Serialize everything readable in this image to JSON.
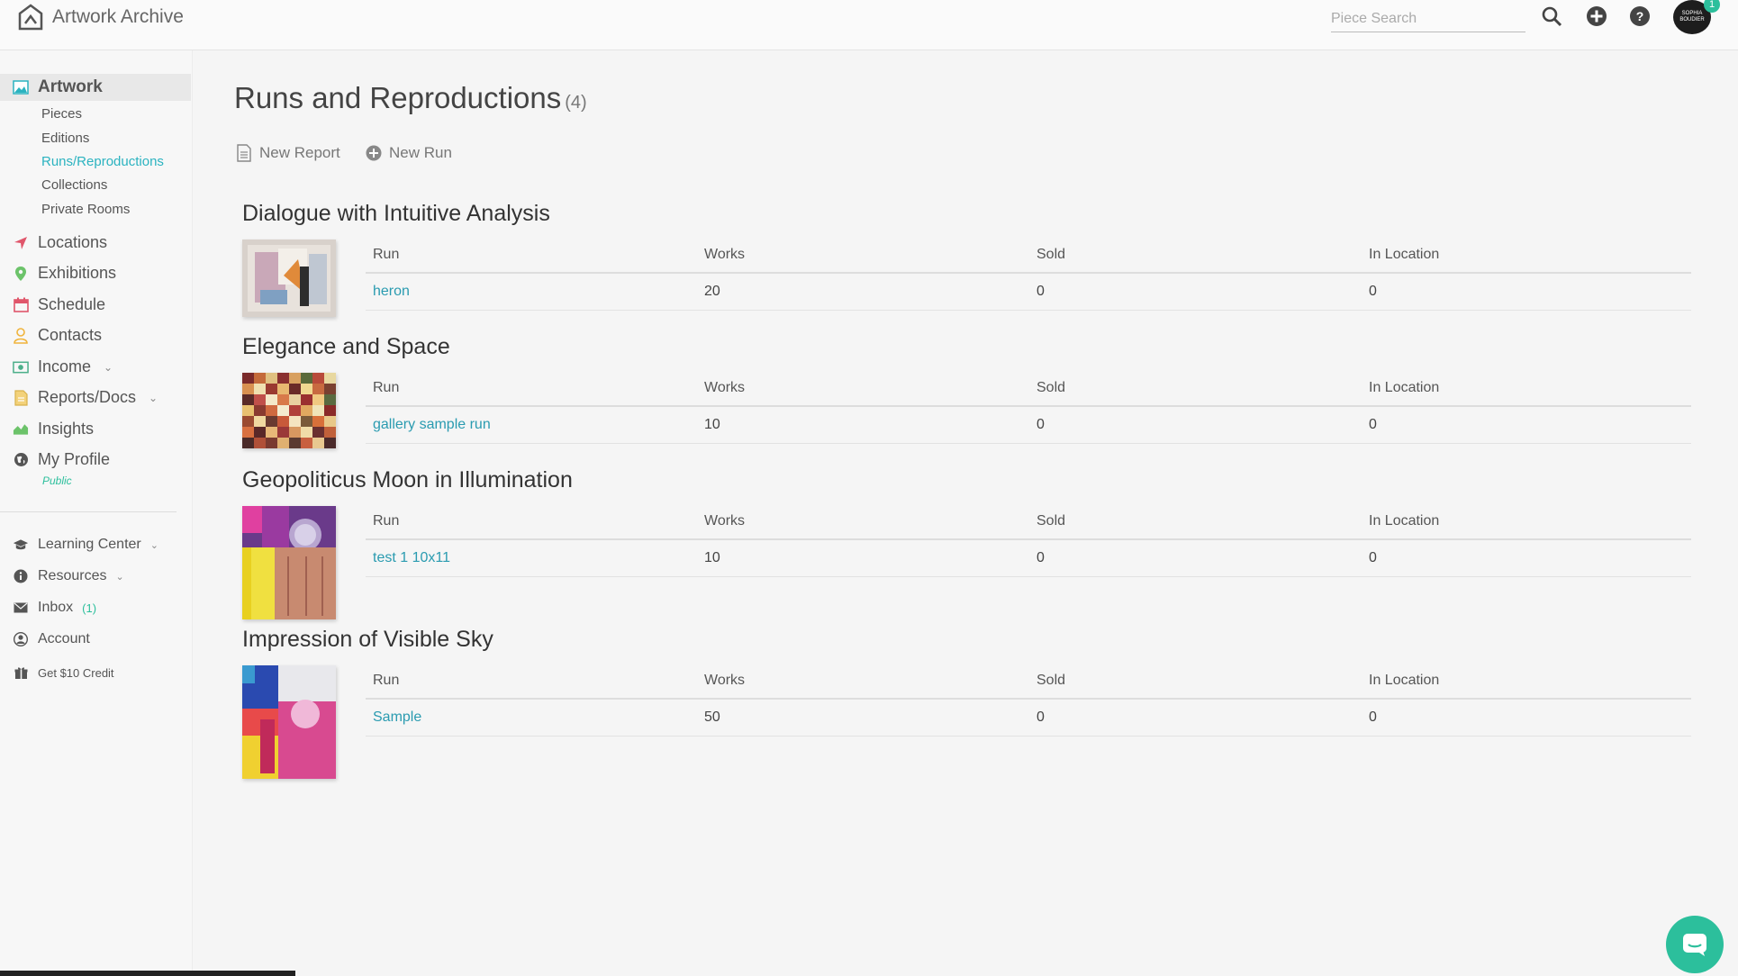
{
  "app": {
    "title": "Artwork Archive"
  },
  "header": {
    "search_placeholder": "Piece Search",
    "avatar_text": "SOPHIA BOUDIER",
    "notification_count": "1"
  },
  "sidebar": {
    "main_label": "Artwork",
    "sub_items": [
      "Pieces",
      "Editions",
      "Runs/Reproductions",
      "Collections",
      "Private Rooms"
    ],
    "active_sub": "Runs/Reproductions",
    "items": [
      "Locations",
      "Exhibitions",
      "Schedule",
      "Contacts",
      "Income",
      "Reports/Docs",
      "Insights",
      "My Profile"
    ],
    "profile_tag": "Public",
    "bottom_items": [
      "Learning Center",
      "Resources",
      "Inbox",
      "Account",
      "Get $10 Credit"
    ],
    "inbox_count": "(1)"
  },
  "page": {
    "title": "Runs and Reproductions",
    "count": "(4)",
    "actions": {
      "new_report": "New Report",
      "new_run": "New Run"
    }
  },
  "table_headers": {
    "run": "Run",
    "works": "Works",
    "sold": "Sold",
    "in_location": "In Location"
  },
  "pieces": [
    {
      "title": "Dialogue with Intuitive Analysis",
      "run": "heron",
      "works": "20",
      "sold": "0",
      "in_location": "0"
    },
    {
      "title": "Elegance and Space",
      "run": "gallery sample run",
      "works": "10",
      "sold": "0",
      "in_location": "0"
    },
    {
      "title": "Geopoliticus Moon in Illumination",
      "run": "test 1 10x11",
      "works": "10",
      "sold": "0",
      "in_location": "0"
    },
    {
      "title": "Impression of Visible Sky",
      "run": "Sample",
      "works": "50",
      "sold": "0",
      "in_location": "0"
    }
  ],
  "colors": {
    "accent_teal": "#2bb3c0",
    "link": "#2a9bb0",
    "green": "#2cbf9c"
  }
}
